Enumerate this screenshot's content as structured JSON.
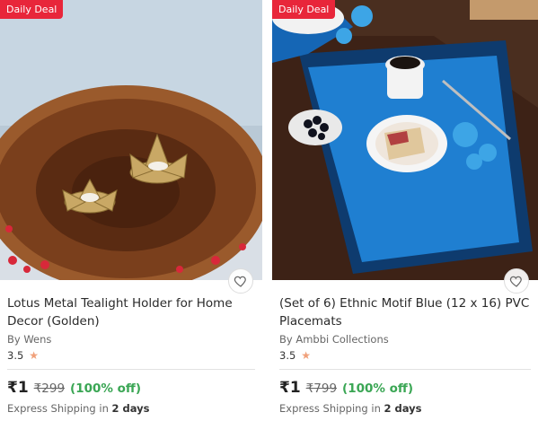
{
  "products": [
    {
      "badge": "Daily Deal",
      "title": "Lotus Metal Tealight Holder for Home Decor (Golden)",
      "brand": "By Wens",
      "rating": "3.5",
      "price": "₹1",
      "mrp": "₹299",
      "discount": "(100% off)",
      "shipping_prefix": "Express Shipping in",
      "shipping_days": "2 days",
      "wishlist_icon": "heart-outline-icon",
      "image_desc": "lotus-tealight-holder-photo"
    },
    {
      "badge": "Daily Deal",
      "title": "(Set of 6) Ethnic Motif Blue (12 x 16) PVC Placemats",
      "brand": "By Ambbi Collections",
      "rating": "3.5",
      "price": "₹1",
      "mrp": "₹799",
      "discount": "(100% off)",
      "shipping_prefix": "Express Shipping in",
      "shipping_days": "2 days",
      "wishlist_icon": "heart-outline-icon",
      "image_desc": "blue-placemat-photo"
    }
  ],
  "colors": {
    "badge_bg": "#e8263a",
    "discount": "#3aa654",
    "star": "#f0a07a"
  }
}
